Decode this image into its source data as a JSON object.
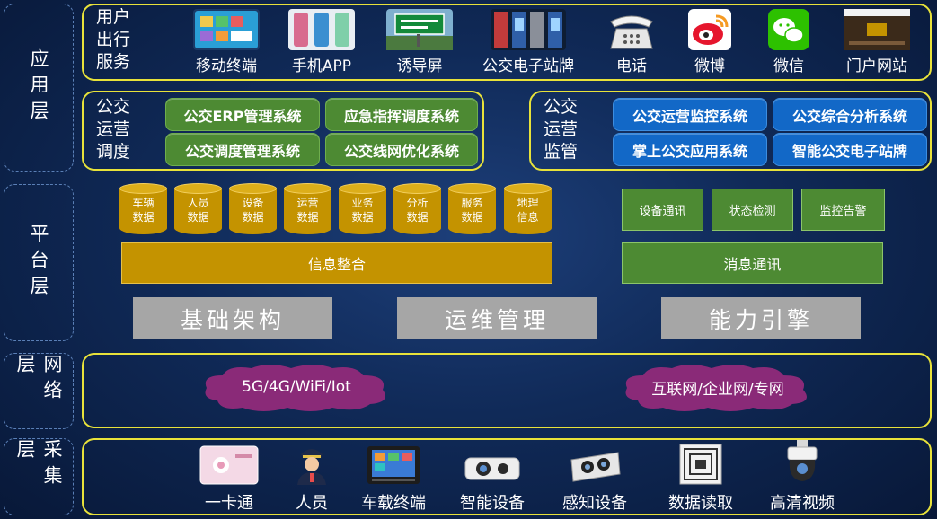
{
  "layers": {
    "application": "应用层",
    "platform": "平台层",
    "network": "网络层",
    "collection": "采集层"
  },
  "user_services": {
    "title_lines": [
      "用户",
      "出行",
      "服务"
    ],
    "items": [
      {
        "label": "移动终端",
        "icon": "mobile-terminal-icon"
      },
      {
        "label": "手机APP",
        "icon": "smartphone-icon"
      },
      {
        "label": "诱导屏",
        "icon": "guidance-screen-icon"
      },
      {
        "label": "公交电子站牌",
        "icon": "electronic-stop-sign-icon"
      },
      {
        "label": "电话",
        "icon": "telephone-icon"
      },
      {
        "label": "微博",
        "icon": "weibo-icon"
      },
      {
        "label": "微信",
        "icon": "wechat-icon"
      },
      {
        "label": "门户网站",
        "icon": "portal-website-icon"
      }
    ]
  },
  "dispatch": {
    "title_lines": [
      "公交",
      "运营",
      "调度"
    ],
    "systems": [
      "公交ERP管理系统",
      "应急指挥调度系统",
      "公交调度管理系统",
      "公交线网优化系统"
    ]
  },
  "monitoring": {
    "title_lines": [
      "公交",
      "运营",
      "监管"
    ],
    "systems": [
      "公交运营监控系统",
      "公交综合分析系统",
      "掌上公交应用系统",
      "智能公交电子站牌"
    ]
  },
  "platform": {
    "databases": [
      [
        "车辆",
        "数据"
      ],
      [
        "人员",
        "数据"
      ],
      [
        "设备",
        "数据"
      ],
      [
        "运营",
        "数据"
      ],
      [
        "业务",
        "数据"
      ],
      [
        "分析",
        "数据"
      ],
      [
        "服务",
        "数据"
      ],
      [
        "地理",
        "信息"
      ]
    ],
    "info_integration": "信息整合",
    "comm_items": [
      "设备通讯",
      "状态检测",
      "监控告警"
    ],
    "messaging": "消息通讯",
    "foundations": [
      "基础架构",
      "运维管理",
      "能力引擎"
    ]
  },
  "network": {
    "wireless": "5G/4G/WiFi/Iot",
    "wired": "互联网/企业网/专网"
  },
  "collection": {
    "items": [
      {
        "label": "一卡通",
        "icon": "smart-card-icon"
      },
      {
        "label": "人员",
        "icon": "staff-icon"
      },
      {
        "label": "车载终端",
        "icon": "vehicle-terminal-icon"
      },
      {
        "label": "智能设备",
        "icon": "smart-device-icon"
      },
      {
        "label": "感知设备",
        "icon": "sensor-device-icon"
      },
      {
        "label": "数据读取",
        "icon": "rfid-reader-icon"
      },
      {
        "label": "高清视频",
        "icon": "hd-camera-icon"
      }
    ]
  },
  "colors": {
    "frame": "#e8e23a",
    "green": "#4d8a33",
    "blue": "#1268c7",
    "gold": "#c49300",
    "gray": "#a6a6a6",
    "cloud": "#8a2a78"
  }
}
